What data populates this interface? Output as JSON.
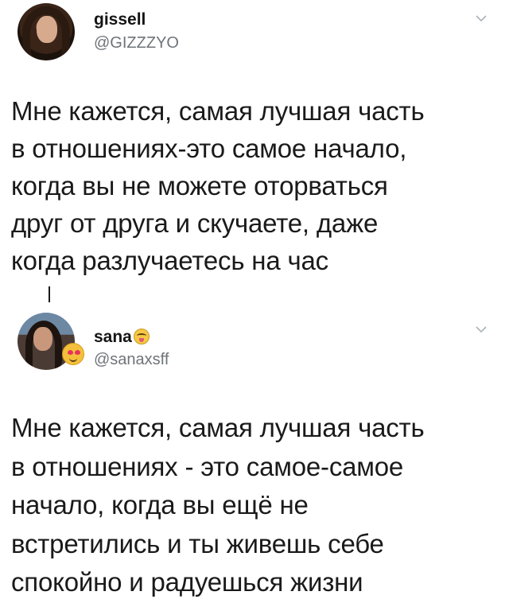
{
  "tweets": [
    {
      "name": "gissell",
      "handle": "@GIZZZYO",
      "avatar_icon": "profile-photo",
      "menu_icon": "chevron-down-icon",
      "text": "Мне кажется, самая лучшая часть\nв отношениях-это самое начало,\nкогда вы не можете оторваться\nдруг от друга и скучаете, даже\nкогда разлучаетесь на час"
    },
    {
      "name": "sana",
      "handle": "@sanaxsff",
      "avatar_icon": "profile-photo",
      "badge_icon": "heart-eyes-emoji-icon",
      "name_emoji_icon": "tongue-out-emoji-icon",
      "menu_icon": "chevron-down-icon",
      "text": "Мне кажется, самая лучшая часть\nв  отношениях - это самое-самое\nначало, когда вы ещё не\nвстретились и ты живешь себе\nспокойно и радуешься жизни"
    }
  ],
  "colors": {
    "text": "#1a1a1a",
    "handle": "#6e7479",
    "chevron": "#aab3ba",
    "background": "#ffffff"
  }
}
